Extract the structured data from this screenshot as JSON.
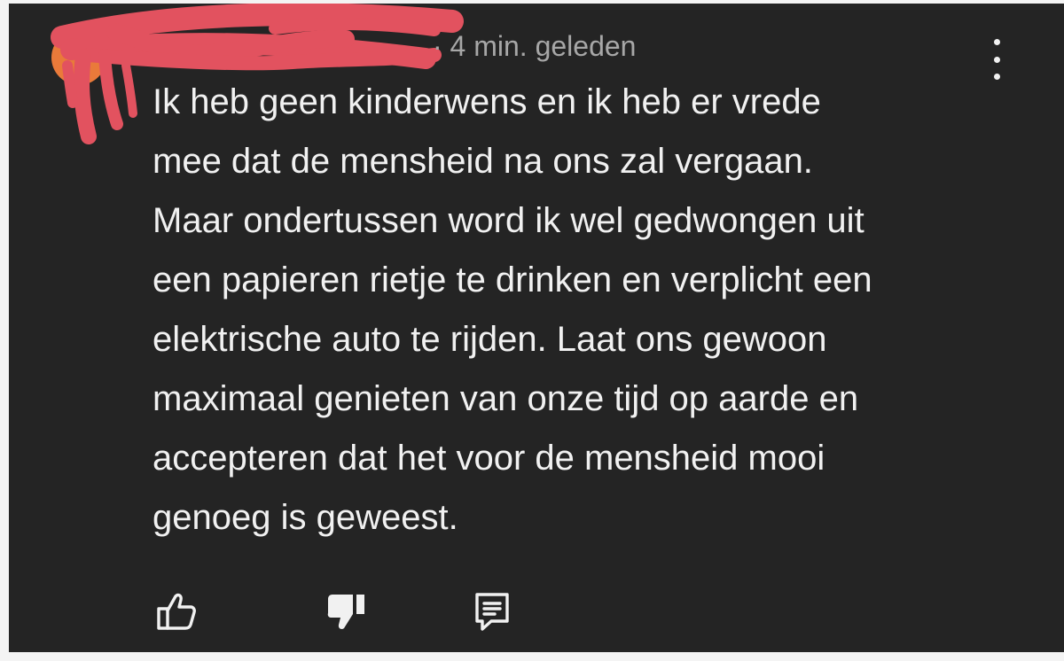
{
  "comment": {
    "timestamp": "· 4 min. geleden",
    "lines": [
      "Ik heb geen kinderwens en ik heb er vrede",
      "mee dat de mensheid na ons zal vergaan.",
      "Maar ondertussen word ik wel gedwongen uit",
      "een papieren rietje te drinken en verplicht een",
      "elektrische auto te rijden. Laat ons gewoon",
      "maximaal genieten van onze tijd op aarde en",
      "accepteren dat het voor de mensheid mooi",
      "genoeg is geweest."
    ]
  },
  "icons": {
    "menu": "more-vertical-icon",
    "like": "thumbs-up-icon",
    "dislike": "thumbs-down-icon",
    "reply": "reply-comment-icon"
  },
  "colors": {
    "background": "#242424",
    "text": "#f1f1f1",
    "meta": "#a7a7a7",
    "redaction": "#e2525f"
  }
}
